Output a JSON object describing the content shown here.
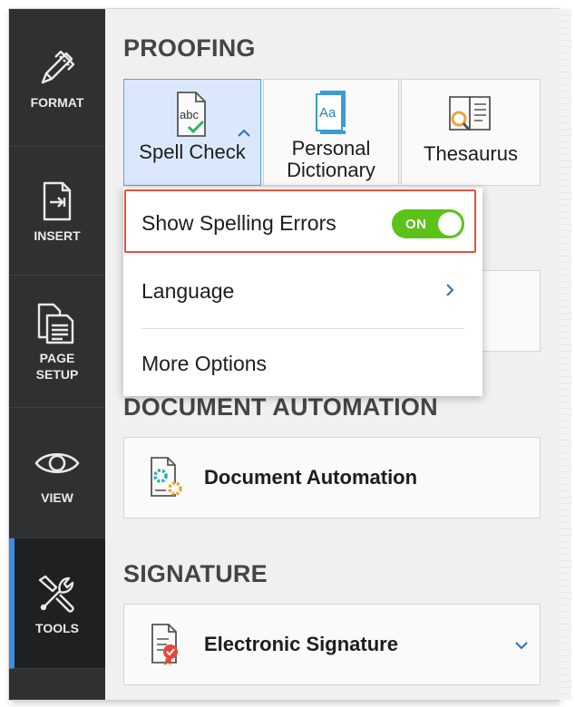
{
  "rail": {
    "items": [
      {
        "label": "FORMAT",
        "icon": "pencil-ruler-icon"
      },
      {
        "label": "INSERT",
        "icon": "insert-document-icon"
      },
      {
        "label": "PAGE\nSETUP",
        "icon": "page-setup-icon"
      },
      {
        "label": "VIEW",
        "icon": "eye-icon"
      },
      {
        "label": "TOOLS",
        "icon": "tools-icon"
      }
    ],
    "active": "TOOLS",
    "active_color": "#3b8ede"
  },
  "proofing": {
    "title": "PROOFING",
    "buttons": [
      {
        "label": "Spell Check",
        "icon": "spell-check-icon",
        "selected": true
      },
      {
        "label": "Personal\nDictionary",
        "icon": "dictionary-icon"
      },
      {
        "label": "Thesaurus",
        "icon": "thesaurus-icon"
      }
    ]
  },
  "spell_menu": {
    "show_errors_label": "Show Spelling Errors",
    "toggle_label": "ON",
    "toggle_on": true,
    "language_label": "Language",
    "more_options_label": "More Options",
    "highlight_color": "#e6523f",
    "toggle_color": "#5cc118"
  },
  "automation": {
    "title": "DOCUMENT AUTOMATION",
    "button_label": "Document Automation"
  },
  "signature": {
    "title": "SIGNATURE",
    "button_label": "Electronic Signature"
  }
}
